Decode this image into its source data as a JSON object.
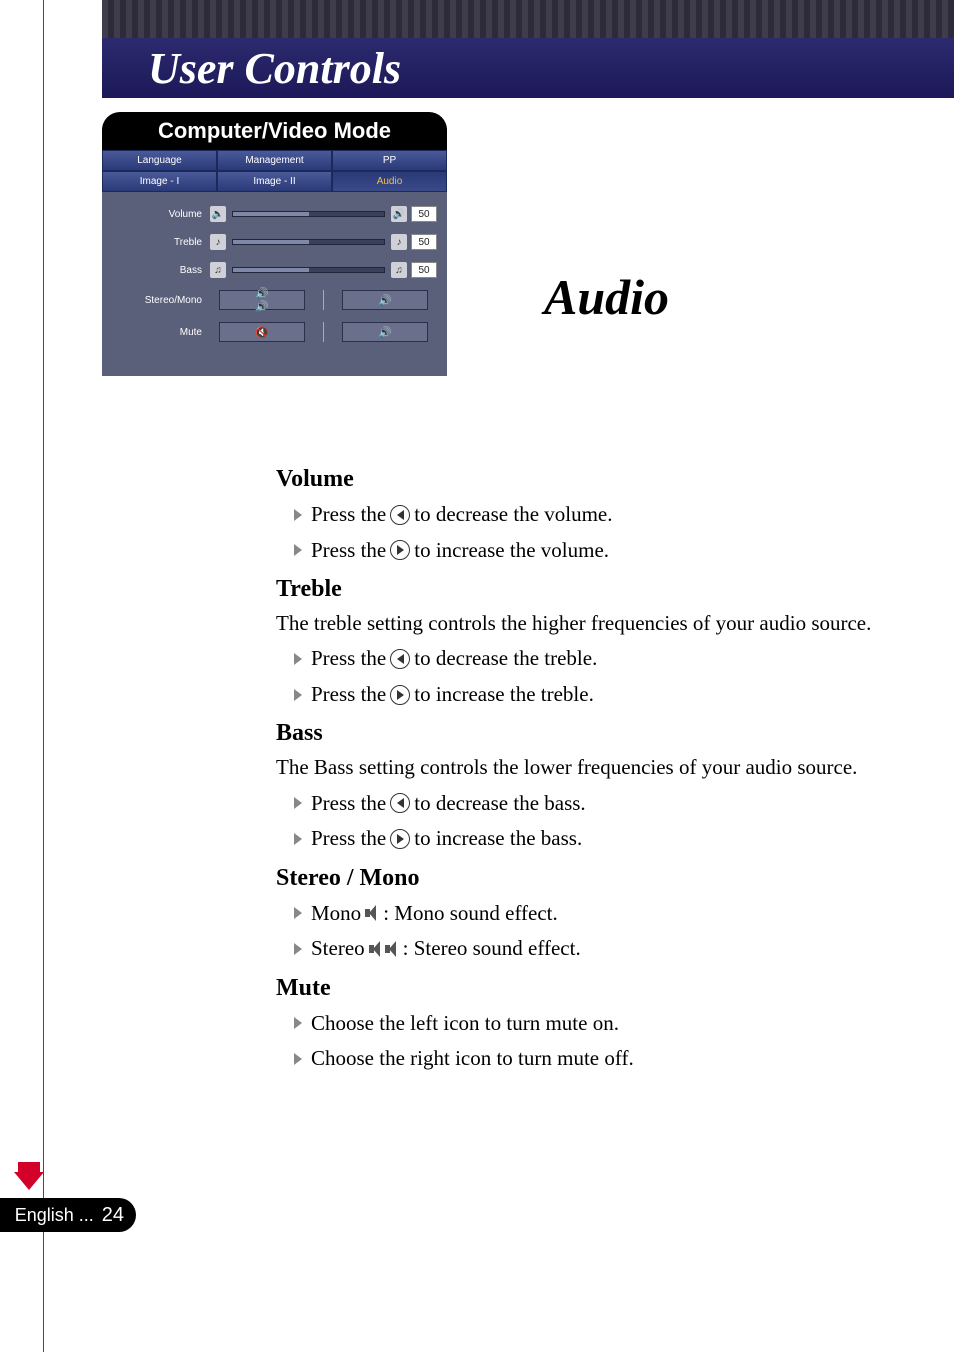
{
  "header": {
    "title": "User Controls"
  },
  "right_heading": "Audio",
  "osd": {
    "title": "Computer/Video Mode",
    "tabs_row1": [
      "Language",
      "Management",
      "PP"
    ],
    "tabs_row2": [
      "Image - I",
      "Image - II",
      "Audio"
    ],
    "active_tab": "Audio",
    "rows": {
      "volume": {
        "label": "Volume",
        "value": "50"
      },
      "treble": {
        "label": "Treble",
        "value": "50"
      },
      "bass": {
        "label": "Bass",
        "value": "50"
      },
      "stereo_mono": {
        "label": "Stereo/Mono"
      },
      "mute": {
        "label": "Mute"
      }
    }
  },
  "sections": {
    "volume": {
      "title": "Volume",
      "b1a": "Press the ",
      "b1b": " to decrease the volume.",
      "b2a": "Press the ",
      "b2b": " to increase the volume."
    },
    "treble": {
      "title": "Treble",
      "desc": "The treble setting controls the higher frequencies of your audio source.",
      "b1a": "Press the ",
      "b1b": " to decrease the treble.",
      "b2a": "Press the ",
      "b2b": " to increase the treble."
    },
    "bass": {
      "title": "Bass",
      "desc": "The Bass setting controls the lower frequencies of your audio source.",
      "b1a": "Press the ",
      "b1b": " to decrease the bass.",
      "b2a": "Press the ",
      "b2b": " to increase the bass."
    },
    "stereo": {
      "title": "Stereo / Mono",
      "b1a": "Mono ",
      "b1b": " : Mono sound effect.",
      "b2a": "Stereo ",
      "b2b": " : Stereo sound effect."
    },
    "mute": {
      "title": "Mute",
      "b1": "Choose the left icon to turn mute on.",
      "b2": "Choose the right icon to turn mute off."
    }
  },
  "footer": {
    "lang": "English ...",
    "page": "24"
  }
}
